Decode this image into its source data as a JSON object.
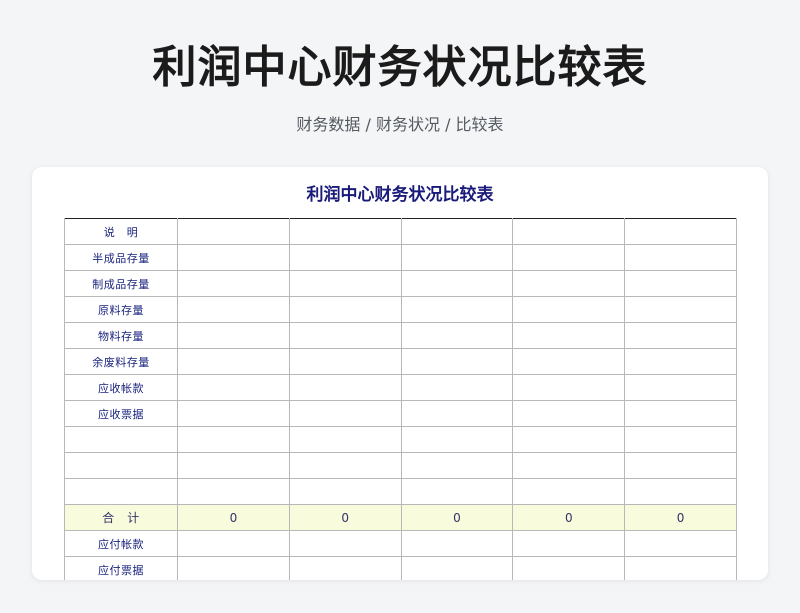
{
  "page": {
    "title": "利润中心财务状况比较表",
    "breadcrumb": "财务数据 / 财务状况 / 比较表"
  },
  "sheet": {
    "title": "利润中心财务状况比较表",
    "rows": [
      {
        "label": "说　明",
        "values": [
          "",
          "",
          "",
          "",
          ""
        ]
      },
      {
        "label": "半成品存量",
        "values": [
          "",
          "",
          "",
          "",
          ""
        ]
      },
      {
        "label": "制成品存量",
        "values": [
          "",
          "",
          "",
          "",
          ""
        ]
      },
      {
        "label": "原料存量",
        "values": [
          "",
          "",
          "",
          "",
          ""
        ]
      },
      {
        "label": "物料存量",
        "values": [
          "",
          "",
          "",
          "",
          ""
        ]
      },
      {
        "label": "余废料存量",
        "values": [
          "",
          "",
          "",
          "",
          ""
        ]
      },
      {
        "label": "应收帐款",
        "values": [
          "",
          "",
          "",
          "",
          ""
        ]
      },
      {
        "label": "应收票据",
        "values": [
          "",
          "",
          "",
          "",
          ""
        ]
      },
      {
        "label": "",
        "values": [
          "",
          "",
          "",
          "",
          ""
        ]
      },
      {
        "label": "",
        "values": [
          "",
          "",
          "",
          "",
          ""
        ]
      },
      {
        "label": "",
        "values": [
          "",
          "",
          "",
          "",
          ""
        ]
      },
      {
        "label": "合　计",
        "values": [
          "0",
          "0",
          "0",
          "0",
          "0"
        ],
        "total": true
      },
      {
        "label": "应付帐款",
        "values": [
          "",
          "",
          "",
          "",
          ""
        ]
      },
      {
        "label": "应付票据",
        "values": [
          "",
          "",
          "",
          "",
          ""
        ]
      }
    ]
  },
  "colors": {
    "label_text": "#1a237e",
    "title_text": "#1a1a7a",
    "total_row_bg": "#f8fbdc",
    "page_bg": "#f4f5f7"
  }
}
